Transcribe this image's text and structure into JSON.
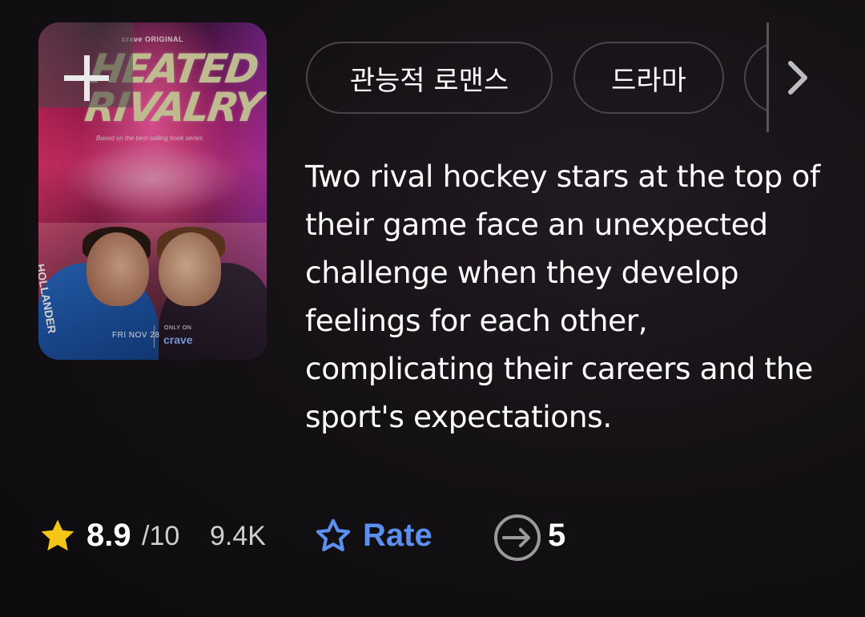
{
  "poster": {
    "brand_top": "crave ORIGINAL",
    "title_line1": "HEATED",
    "title_line2": "RIVALRY",
    "subtitle": "Based on the best-selling book series",
    "jersey_text": "HOLLANDER",
    "date": "FRI NOV 28",
    "only_on": "ONLY ON",
    "logo": "crave"
  },
  "genres": [
    "관능적 로맨스",
    "드라마",
    ""
  ],
  "description": "Two rival hockey stars at the top of their game face an unexpected challenge when they develop feelings for each other, complicating their careers and the sport's expectations.",
  "stats": {
    "rating": "8.9",
    "rating_max": "/10",
    "votes": "9.4K",
    "rate_label": "Rate",
    "share_count": "5"
  },
  "icons": {
    "add": "plus-icon",
    "more_genres": "chevron-right-icon",
    "star": "star-icon",
    "rate": "star-outline-icon",
    "share": "arrow-circle-icon"
  },
  "colors": {
    "accent_blue": "#5b8ff0",
    "star_yellow": "#f5c518",
    "chip_border": "#4a4448"
  }
}
